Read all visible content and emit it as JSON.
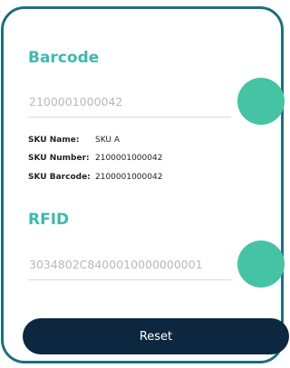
{
  "barcode": {
    "title": "Barcode",
    "value": "2100001000042",
    "sku": [
      {
        "label": "SKU Name:",
        "value": "SKU A"
      },
      {
        "label": "SKU Number:",
        "value": "2100001000042"
      },
      {
        "label": "SKU Barcode:",
        "value": "2100001000042"
      }
    ]
  },
  "rfid": {
    "title": "RFID",
    "value": "3034802C8400010000000001"
  },
  "actions": {
    "reset_label": "Reset"
  },
  "colors": {
    "accent": "#3fb8b0",
    "scan_button": "#46c3a4",
    "primary_dark": "#0d2740",
    "frame_border": "#1f6f7c"
  }
}
